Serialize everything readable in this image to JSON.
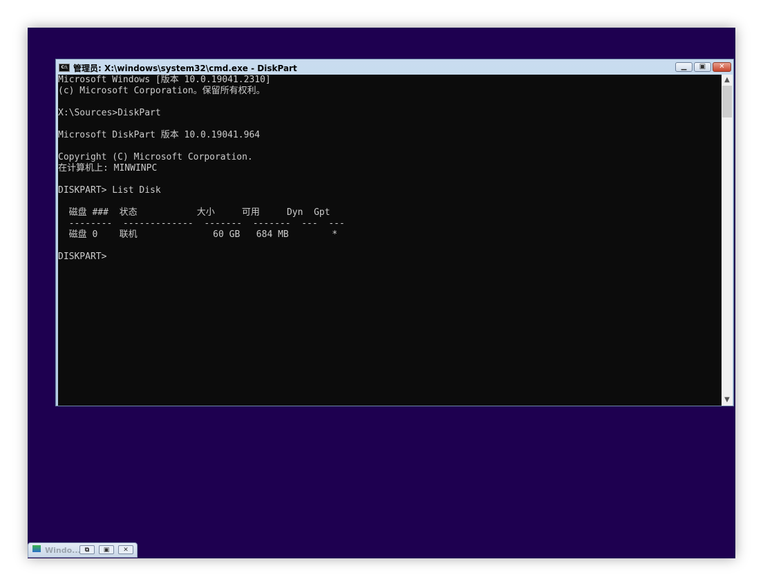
{
  "window": {
    "title": "管理员: X:\\windows\\system32\\cmd.exe - DiskPart",
    "minimize": "▁",
    "maximize": "▣",
    "close": "✕"
  },
  "terminal": {
    "lines": [
      "Microsoft Windows [版本 10.0.19041.2310]",
      "(c) Microsoft Corporation。保留所有权利。",
      "",
      "X:\\Sources>DiskPart",
      "",
      "Microsoft DiskPart 版本 10.0.19041.964",
      "",
      "Copyright (C) Microsoft Corporation.",
      "在计算机上: MINWINPC",
      "",
      "DISKPART> List Disk",
      "",
      "  磁盘 ###  状态           大小     可用     Dyn  Gpt",
      "  --------  -------------  -------  -------  ---  ---",
      "  磁盘 0    联机              60 GB   684 MB        *",
      "",
      "DISKPART> "
    ]
  },
  "taskbar": {
    "label": "Windo...",
    "restore": "⧉",
    "maximize": "▣",
    "close": "✕"
  }
}
